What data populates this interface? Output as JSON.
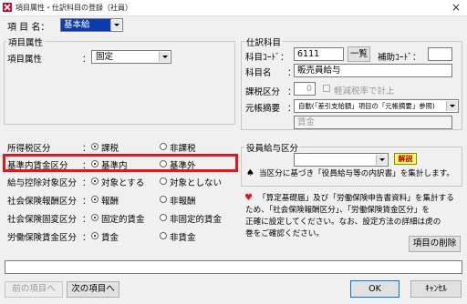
{
  "window": {
    "title": "項目属性・仕訳科目の登録（社員）",
    "close_glyph": "×"
  },
  "item_name": {
    "label": "項 目 名：",
    "value": "基本給"
  },
  "attr_group": {
    "legend": "項目属性",
    "attr_label": "項目属性",
    "attr_value": "固定"
  },
  "tax": {
    "label": "所得税区分",
    "opt1": "課税",
    "opt2": "非課税"
  },
  "standard": {
    "label": "基準内賃金区分",
    "opt1": "基準内",
    "opt2": "基準外"
  },
  "deduction": {
    "label": "給与控除対象区分",
    "opt1": "対象とする",
    "opt2": "対象としない"
  },
  "social_comp": {
    "label": "社会保険報酬区分",
    "opt1": "報酬",
    "opt2": "非報酬"
  },
  "social_fixed": {
    "label": "社会保険固変区分",
    "opt1": "固定的賃金",
    "opt2": "非固定的賃金"
  },
  "labor": {
    "label": "労働保険賃金区分",
    "opt1": "賃金",
    "opt2": "非賃金"
  },
  "colon": "：",
  "journal": {
    "legend": "仕訳科目",
    "code_label": "科目ｺｰﾄﾞ：",
    "code_value": "6111",
    "list_button": "一覧",
    "aux_label": "補助ｺｰﾄﾞ：",
    "aux_value": "",
    "name_label": "科目名",
    "name_value": "販売員給与",
    "tax_label": "課税区分",
    "tax_value": "0",
    "reduced_label": "軽減税率で計上",
    "summary_label": "元帳摘要",
    "summary_value": "自動(「差引支給額」項目の「元帳摘要」参照)",
    "summary_text": "賃金"
  },
  "officer": {
    "legend": "役員給与区分",
    "combo_value": "",
    "kaisetsu": "解説",
    "spade": "♠",
    "note": "当区分に基づき「役員給与等の内訳書」を集計します。"
  },
  "notice": {
    "heart": "♥",
    "line1": "「算定基礎届」及び「労働保険申告書資料」を集計する",
    "line2": "ため、「社会保険報酬区分」、「労働保険賃金区分」を",
    "line3": "正確に設定してください。なお、設定方法の詳細は虎の",
    "line4": "巻をご確認ください。"
  },
  "buttons": {
    "delete": "項目の削除",
    "prev": "前の項目へ",
    "next": "次の項目へ",
    "ok": "OK",
    "cancel": "ｷｬﾝｾﾙ"
  },
  "colors": {
    "accent_red": "#e8141b",
    "selection_blue": "#0a3cad"
  }
}
